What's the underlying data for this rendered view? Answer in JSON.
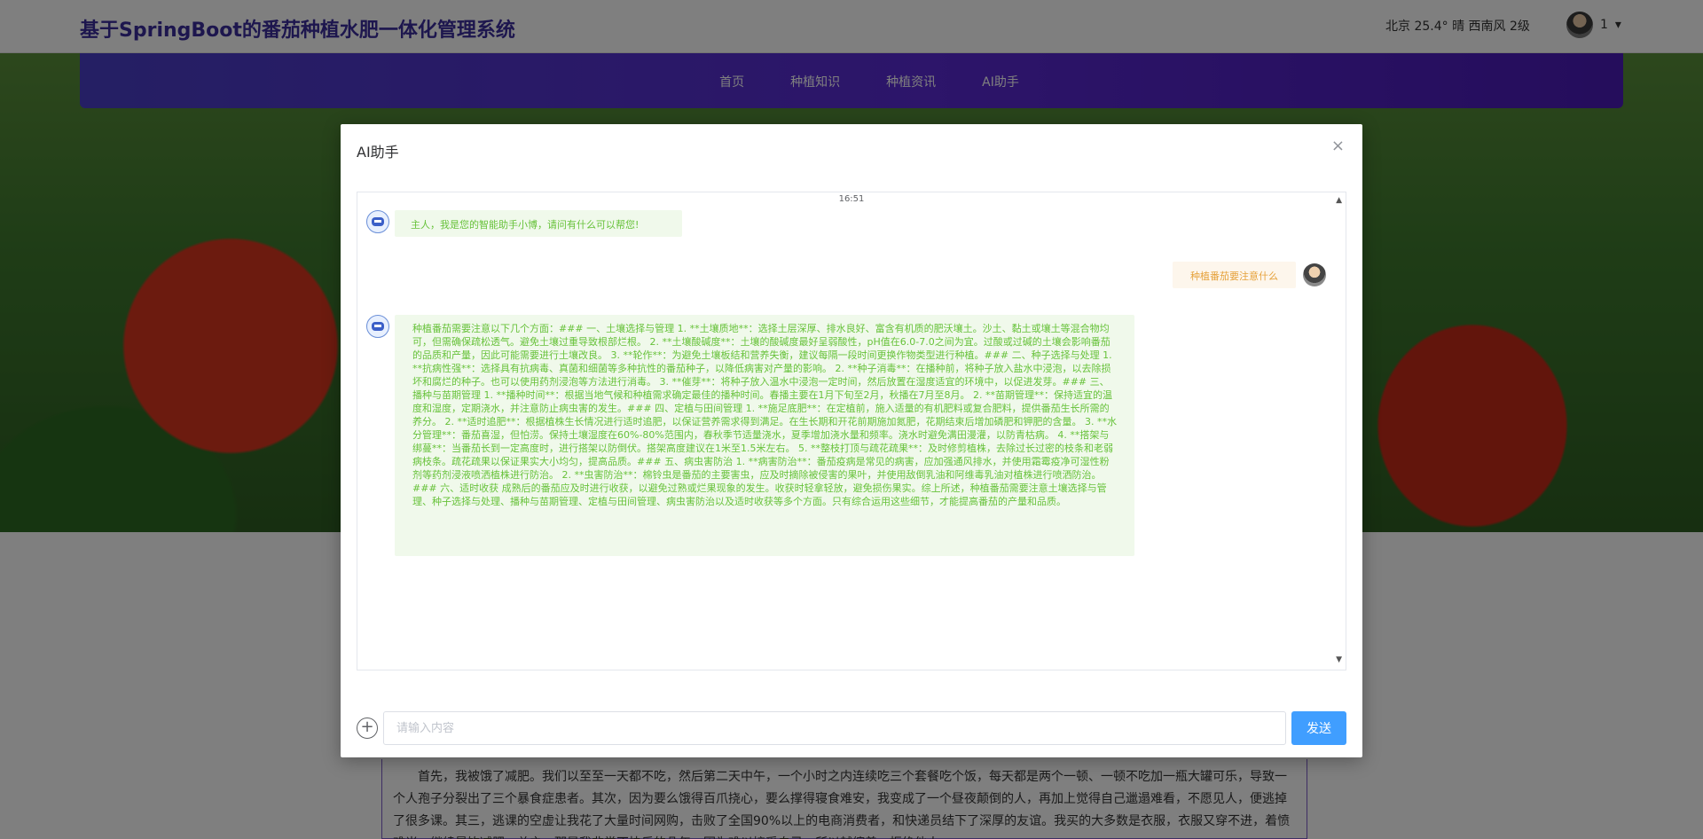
{
  "header": {
    "site_title": "基于SpringBoot的番茄种植水肥一体化管理系统",
    "weather": "北京  25.4°  晴  西南风  2级",
    "username": "1",
    "dropdown_caret": "▾"
  },
  "nav": {
    "items": [
      {
        "label": "首页"
      },
      {
        "label": "种植知识"
      },
      {
        "label": "种植资讯"
      },
      {
        "label": "AI助手"
      }
    ]
  },
  "article": {
    "text": "首先，我被饿了减肥。我们以至至一天都不吃，然后第二天中午，一个小时之内连续吃三个套餐吃个饭，每天都是两个一顿、一顿不吃加一瓶大罐可乐，导致一个人孢子分裂出了三个暴食症患者。其次，因为要么饿得百爪挠心，要么撑得寝食难安，我变成了一个昼夜颠倒的人，再加上觉得自己邋遢难看，不愿见人，便逃掉了很多课。其三，逃课的空虚让我花了大量时间网购，击败了全国90%以上的电商消费者，和快递员结下了深厚的友谊。我买的大多数是衣服，衣服又穿不进，着愤难当，继续暴饮减肥。总之，那是我非常不快乐的几年。因为难以接受自己，所以越缩着，拒绝他人。"
  },
  "modal": {
    "title": "AI助手",
    "close_icon": "×",
    "timestamp": "16:51",
    "messages": [
      {
        "role": "bot",
        "text": "主人，我是您的智能助手小博，请问有什么可以帮您!"
      },
      {
        "role": "user",
        "text": "种植番茄要注意什么"
      },
      {
        "role": "bot",
        "text": "种植番茄需要注意以下几个方面：### 一、土壤选择与管理 1. **土壤质地**：选择土层深厚、排水良好、富含有机质的肥沃壤土。沙土、黏土或壤土等混合物均可，但需确保疏松透气。避免土壤过重导致根部烂根。 2. **土壤酸碱度**：土壤的酸碱度最好呈弱酸性，pH值在6.0-7.0之间为宜。过酸或过碱的土壤会影响番茄的品质和产量，因此可能需要进行土壤改良。 3. **轮作**：为避免土壤板结和营养失衡，建议每隔一段时间更换作物类型进行种植。### 二、种子选择与处理 1. **抗病性强**：选择具有抗病毒、真菌和细菌等多种抗性的番茄种子，以降低病害对产量的影响。 2. **种子消毒**：在播种前，将种子放入盐水中浸泡，以去除损坏和腐烂的种子。也可以使用药剂浸泡等方法进行消毒。 3. **催芽**：将种子放入温水中浸泡一定时间，然后放置在湿度适宜的环境中，以促进发芽。### 三、播种与苗期管理 1. **播种时间**：根据当地气候和种植需求确定最佳的播种时间。春播主要在1月下旬至2月，秋播在7月至8月。 2. **苗期管理**：保持适宜的温度和湿度，定期浇水，并注意防止病虫害的发生。### 四、定植与田间管理 1. **施足底肥**：在定植前，施入适量的有机肥料或复合肥料，提供番茄生长所需的养分。 2. **适时追肥**：根据植株生长情况进行适时追肥，以保证营养需求得到满足。在生长期和开花前期施加氮肥，花期结束后增加磷肥和钾肥的含量。 3. **水分管理**：番茄喜湿，但怕涝。保持土壤湿度在60%-80%范围内，春秋季节适量浇水，夏季增加浇水量和频率。浇水时避免满田漫灌，以防青枯病。 4. **搭架与绑蔓**：当番茄长到一定高度时，进行搭架以防倒伏。搭架高度建议在1米至1.5米左右。 5. **整枝打顶与疏花疏果**：及时修剪植株，去除过长过密的枝条和老弱病枝条。疏花疏果以保证果实大小均匀，提高品质。### 五、病虫害防治 1. **病害防治**：番茄疫病是常见的病害，应加强通风排水，并使用霜霉疫净可湿性粉剂等药剂浸液喷洒植株进行防治。 2. **虫害防治**：棉铃虫是番茄的主要害虫，应及时摘除被侵害的果叶，并使用敌倒乳油和阿维毒乳油对植株进行喷洒防治。### 六、适时收获 成熟后的番茄应及时进行收获，以避免过熟或烂果现象的发生。收获时轻拿轻放，避免损伤果实。综上所述，种植番茄需要注意土壤选择与管理、种子选择与处理、播种与苗期管理、定植与田间管理、病虫害防治以及适时收获等多个方面。只有综合运用这些细节，才能提高番茄的产量和品质。"
      }
    ],
    "input_placeholder": "请输入内容",
    "input_value": "",
    "add_icon": "+",
    "send_label": "发送"
  },
  "colors": {
    "title": "#3a2d9c",
    "nav_bg": "#5a2ad4",
    "bot_bubble_bg": "#f0f9eb",
    "bot_bubble_text": "#67c23a",
    "user_bubble_bg": "#fdf6ec",
    "user_bubble_text": "#e6a23c",
    "send_button": "#409eff"
  },
  "icons": [
    "user-avatar",
    "caret-down-icon",
    "close-icon",
    "robot-icon",
    "add-circle-icon",
    "scroll-up-icon",
    "scroll-down-icon"
  ]
}
